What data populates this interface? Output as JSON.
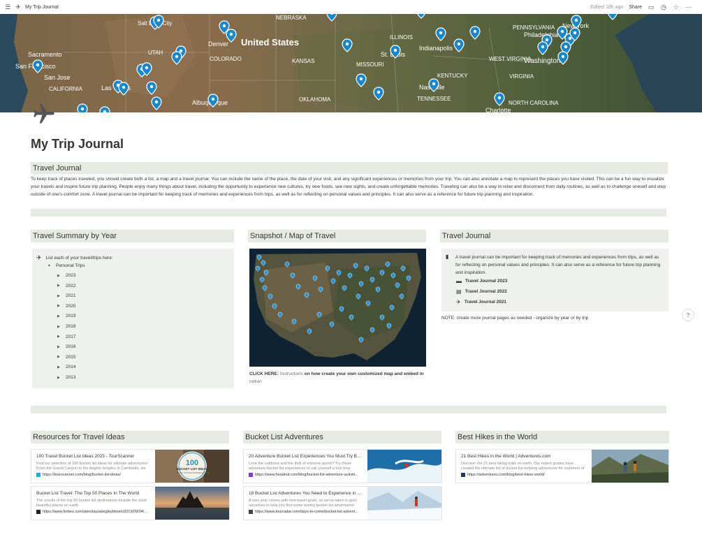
{
  "topbar": {
    "title": "My Trip Journal",
    "edited": "Edited 18h ago",
    "share": "Share"
  },
  "cover_map": {
    "labels": {
      "nebraska": "NEBRASKA",
      "salt_lake": "Salt Lake City",
      "denver": "Denver",
      "us": "United States",
      "illinois": "ILLINOIS",
      "indianapolis": "Indianapolis",
      "pennsylvania": "PENNSYLVANIA",
      "new_york": "New York",
      "philadelphia": "Philadelphia",
      "sacramento": "Sacramento",
      "utah": "UTAH",
      "colorado": "COLORADO",
      "st_louis": "St. Louis",
      "washington": "Washington",
      "west_virginia": "WEST VIRGINIA",
      "san_francisco": "San Francisco",
      "kansas": "KANSAS",
      "missouri": "MISSOURI",
      "virginia": "VIRGINIA",
      "san_jose": "San Jose",
      "kentucky": "KENTUCKY",
      "california": "CALIFORNIA",
      "las_vegas": "Las Vegas",
      "nashville": "Nashville",
      "tennessee": "TENNESSEE",
      "oklahoma": "OKLAHOMA",
      "albuquerque": "Albuquerque",
      "north_carolina": "NORTH CAROLINA",
      "charlotte": "Charlotte"
    }
  },
  "page": {
    "title": "My Trip Journal"
  },
  "intro": {
    "heading": "Travel Journal",
    "body": "To keep track of places traveled, you should create both a list, a map and a travel journal.  You can include the name of the place, the date of your visit, and any significant experiences or memories from your trip. You can also annotate a map to represent the places you have visited. This can be a fun way to visualize your travels and inspire future trip planning.  People enjoy many things about travel, including the opportunity to experience new cultures, try new foods, see new sights, and create unforgettable memories. Traveling can also be a way to relax and disconnect from daily routines, as well as to challenge oneself and step outside of one's comfort zone.  A travel journal can be important for keeping track of memories and experiences from trips, as well as for reflecting on personal values and principles. It can also serve as a reference for future trip planning and inspiration."
  },
  "summary": {
    "heading": "Travel Summary by Year",
    "intro": "List each of your travel/trips here:",
    "group": "Personal Trips",
    "years": [
      "2023",
      "2022",
      "2021",
      "2020",
      "2019",
      "2018",
      "2017",
      "2016",
      "2015",
      "2014",
      "2013"
    ]
  },
  "snapshot": {
    "heading": "Snapshot / Map of Travel",
    "click_here": "CLICK HERE:",
    "instructions_a": " Instructions",
    "instructions_b": " on how create your own customized map and embed in",
    "notion": " notion"
  },
  "journal": {
    "heading": "Travel Journal",
    "text": "A travel journal can be important for keeping track of memories and experiences from trips, as well as for reflecting on personal values and principles. It can also serve as a reference for future trip planning and inspiration.",
    "links": [
      "Travel Journal 2023",
      "Travel Journal 2022",
      "Travel Journal 2021"
    ],
    "note": "NOTE:  create more journal pages as needed - organize by year or by trip"
  },
  "resources": {
    "heading": "Resources for Travel Ideas",
    "items": [
      {
        "title": "100 Travel Bucket List Ideas 2023 - TourScanner",
        "desc": "Find our selection of 100 bucket list ideas for ultimate adventures! From the Grand Canyon to the Angkor temples in Cambodia, we",
        "url": "https://tourscanner.com/blog/bucket-list-ideas/",
        "thumb_text": [
          "100",
          "BUCKET LIST IDEAS",
          "FOR THE ULTIMATE WANDERLUSTERS"
        ]
      },
      {
        "title": "Bucket List Travel: The Top 50 Places In The World",
        "desc": "The results of the top 50 bucket list destinations include the most beautiful places on earth.",
        "url": "https://www.forbes.com/sites/laurabegleybloom/2019/09/04/..."
      }
    ]
  },
  "bucket": {
    "heading": "Bucket List Adventures",
    "items": [
      {
        "title": "20 Adventure Bucket List Experiences You Must Try Befo...",
        "desc": "Love the outdoors and the thrill of extreme sports? Try these adventure bucket list experiences to call yourself a true blue",
        "url": "https://www.headout.com/blog/bucket-list-adventure-activiti..."
      },
      {
        "title": "18 Bucket List Adventures You Need to Experience in 20...",
        "desc": "A new year comes with new travel goals, so we've taken it upon ourselves to help you find some worthy bucket list adventures!",
        "url": "https://www.tourradar.com/days-to-come/bucket-list-advent..."
      }
    ]
  },
  "hikes": {
    "heading": "Best Hikes in the World",
    "items": [
      {
        "title": "21 Best Hikes in the World | Adventures.com",
        "desc": "Discover the 21 best hiking trails on earth. Our expert guides have created the ultimate list of bucket list trekking adventures for explorers of all",
        "url": "https://adventures.com/blog/best-hikes-world/"
      }
    ]
  },
  "colors": {
    "band": "#e5eae3",
    "panel": "#eef1ed",
    "pin": "#1a87c9"
  }
}
